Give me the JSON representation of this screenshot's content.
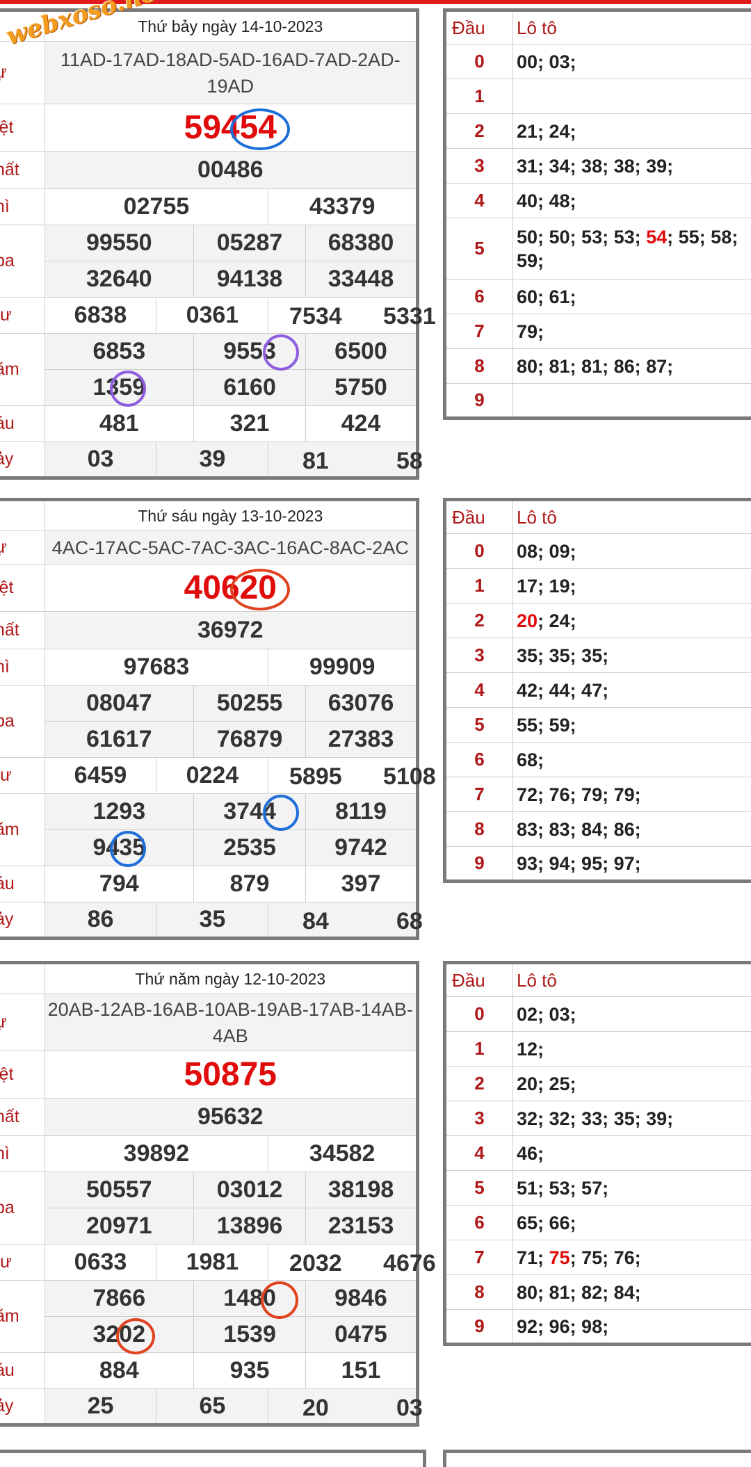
{
  "watermark": "webxoso.net",
  "labels": {
    "ky_hieu": "ự",
    "dac_biet": "iệt",
    "nhat": "hất",
    "nhi": "hì",
    "ba": "ba",
    "tu": "tư",
    "nam": "ăm",
    "sau": "áu",
    "bay": "ảy"
  },
  "loto_headers": {
    "dau": "Đầu",
    "loto": "Lô tô"
  },
  "colors": {
    "accent_red": "#e00b0b",
    "label_red": "#b01818",
    "ring_blue": "#1f6fd8",
    "ring_purple": "#8f5ee0",
    "ring_orange": "#e0421f"
  },
  "draws": [
    {
      "title": "Thứ bảy ngày 14-10-2023",
      "codes": "11AD-17AD-18AD-5AD-16AD-7AD-2AD-19AD",
      "special": "59454",
      "first": "00486",
      "second": [
        "02755",
        "43379"
      ],
      "third": [
        "99550",
        "05287",
        "68380",
        "32640",
        "94138",
        "33448"
      ],
      "fourth": [
        "6838",
        "0361",
        "7534",
        "5331"
      ],
      "fifth": [
        "6853",
        "9553",
        "6500",
        "1359",
        "6160",
        "5750"
      ],
      "sixth": [
        "481",
        "321",
        "424"
      ],
      "seventh": [
        "03",
        "39",
        "81",
        "58"
      ],
      "loto": [
        {
          "head": "0",
          "tails": "00; 03;"
        },
        {
          "head": "1",
          "tails": ""
        },
        {
          "head": "2",
          "tails": "21; 24;"
        },
        {
          "head": "3",
          "tails": "31; 34; 38; 38; 39;"
        },
        {
          "head": "4",
          "tails": "40; 48;"
        },
        {
          "head": "5",
          "pre": "50; 50; 53; 53; ",
          "hl": "54",
          "post": "; 55; 58; 59;"
        },
        {
          "head": "6",
          "tails": "60; 61;"
        },
        {
          "head": "7",
          "tails": "79;"
        },
        {
          "head": "8",
          "tails": "80; 81; 81; 86; 87;"
        },
        {
          "head": "9",
          "tails": ""
        }
      ]
    },
    {
      "title": "Thứ sáu ngày 13-10-2023",
      "codes": "4AC-17AC-5AC-7AC-3AC-16AC-8AC-2AC",
      "special": "40620",
      "first": "36972",
      "second": [
        "97683",
        "99909"
      ],
      "third": [
        "08047",
        "50255",
        "63076",
        "61617",
        "76879",
        "27383"
      ],
      "fourth": [
        "6459",
        "0224",
        "5895",
        "5108"
      ],
      "fifth": [
        "1293",
        "3744",
        "8119",
        "9435",
        "2535",
        "9742"
      ],
      "sixth": [
        "794",
        "879",
        "397"
      ],
      "seventh": [
        "86",
        "35",
        "84",
        "68"
      ],
      "loto": [
        {
          "head": "0",
          "tails": "08; 09;"
        },
        {
          "head": "1",
          "tails": "17; 19;"
        },
        {
          "head": "2",
          "pre": "",
          "hl": "20",
          "post": "; 24;"
        },
        {
          "head": "3",
          "tails": "35; 35; 35;"
        },
        {
          "head": "4",
          "tails": "42; 44; 47;"
        },
        {
          "head": "5",
          "tails": "55; 59;"
        },
        {
          "head": "6",
          "tails": "68;"
        },
        {
          "head": "7",
          "tails": "72; 76; 79; 79;"
        },
        {
          "head": "8",
          "tails": "83; 83; 84; 86;"
        },
        {
          "head": "9",
          "tails": "93; 94; 95; 97;"
        }
      ]
    },
    {
      "title": "Thứ năm ngày 12-10-2023",
      "codes": "20AB-12AB-16AB-10AB-19AB-17AB-14AB-4AB",
      "special": "50875",
      "first": "95632",
      "second": [
        "39892",
        "34582"
      ],
      "third": [
        "50557",
        "03012",
        "38198",
        "20971",
        "13896",
        "23153"
      ],
      "fourth": [
        "0633",
        "1981",
        "2032",
        "4676"
      ],
      "fifth": [
        "7866",
        "1480",
        "9846",
        "3202",
        "1539",
        "0475"
      ],
      "sixth": [
        "884",
        "935",
        "151"
      ],
      "seventh": [
        "25",
        "65",
        "20",
        "03"
      ],
      "loto": [
        {
          "head": "0",
          "tails": "02; 03;"
        },
        {
          "head": "1",
          "tails": "12;"
        },
        {
          "head": "2",
          "tails": "20; 25;"
        },
        {
          "head": "3",
          "tails": "32; 32; 33; 35; 39;"
        },
        {
          "head": "4",
          "tails": "46;"
        },
        {
          "head": "5",
          "tails": "51; 53; 57;"
        },
        {
          "head": "6",
          "tails": "65; 66;"
        },
        {
          "head": "7",
          "pre": "71; ",
          "hl": "75",
          "post": "; 75; 76;"
        },
        {
          "head": "8",
          "tails": "80; 81; 82; 84;"
        },
        {
          "head": "9",
          "tails": "92; 96; 98;"
        }
      ]
    }
  ]
}
